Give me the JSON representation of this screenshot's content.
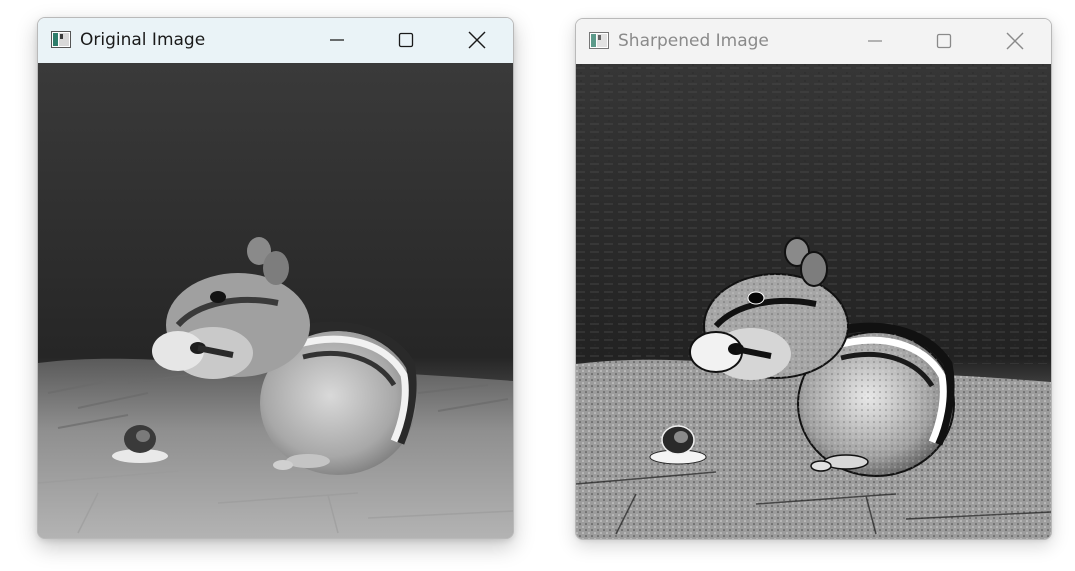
{
  "windows": [
    {
      "title": "Original Image",
      "active": true,
      "icon": "app-icon",
      "controls": [
        "minimize-icon",
        "maximize-icon",
        "close-icon"
      ],
      "image": "grayscale photo of a chipmunk eating, with a small snail on a dish"
    },
    {
      "title": "Sharpened Image",
      "active": false,
      "icon": "app-icon",
      "controls": [
        "minimize-icon",
        "maximize-icon",
        "close-icon"
      ],
      "image": "sharpened grayscale photo of the same chipmunk scene"
    }
  ],
  "colors": {
    "active_titlebar": "#eaf3f7",
    "inactive_titlebar": "#f3f3f3",
    "active_title_text": "#1a1a1a",
    "inactive_title_text": "#8a8a8a"
  }
}
